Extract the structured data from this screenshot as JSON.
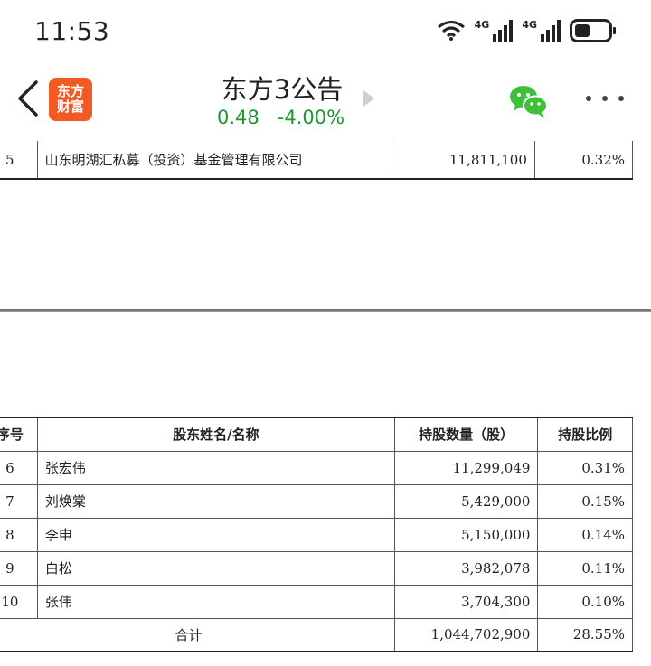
{
  "status_bar": {
    "time": "11:53",
    "network_1": "4G",
    "network_2": "4G",
    "icons": [
      "wifi-icon",
      "signal-icon",
      "signal-icon",
      "battery-icon"
    ]
  },
  "nav": {
    "logo_line1": "东方",
    "logo_line2": "财富",
    "title": "东方3公告",
    "price": "0.48",
    "change": "-4.00%",
    "accent_color": "#1a9a2a",
    "logo_color": "#f15a22"
  },
  "document": {
    "top_row": {
      "seq": "5",
      "name": "山东明湖汇私募（投资）基金管理有限公司",
      "shares": "11,811,100",
      "pct": "0.32%"
    },
    "headers": {
      "seq": "序号",
      "name": "股东姓名/名称",
      "shares": "持股数量（股）",
      "pct": "持股比例"
    },
    "rows": [
      {
        "seq": "6",
        "name": "张宏伟",
        "shares": "11,299,049",
        "pct": "0.31%"
      },
      {
        "seq": "7",
        "name": "刘焕棠",
        "shares": "5,429,000",
        "pct": "0.15%"
      },
      {
        "seq": "8",
        "name": "李申",
        "shares": "5,150,000",
        "pct": "0.14%"
      },
      {
        "seq": "9",
        "name": "白松",
        "shares": "3,982,078",
        "pct": "0.11%"
      },
      {
        "seq": "10",
        "name": "张伟",
        "shares": "3,704,300",
        "pct": "0.10%"
      }
    ],
    "total": {
      "label": "合计",
      "shares": "1,044,702,900",
      "pct": "28.55%"
    }
  }
}
